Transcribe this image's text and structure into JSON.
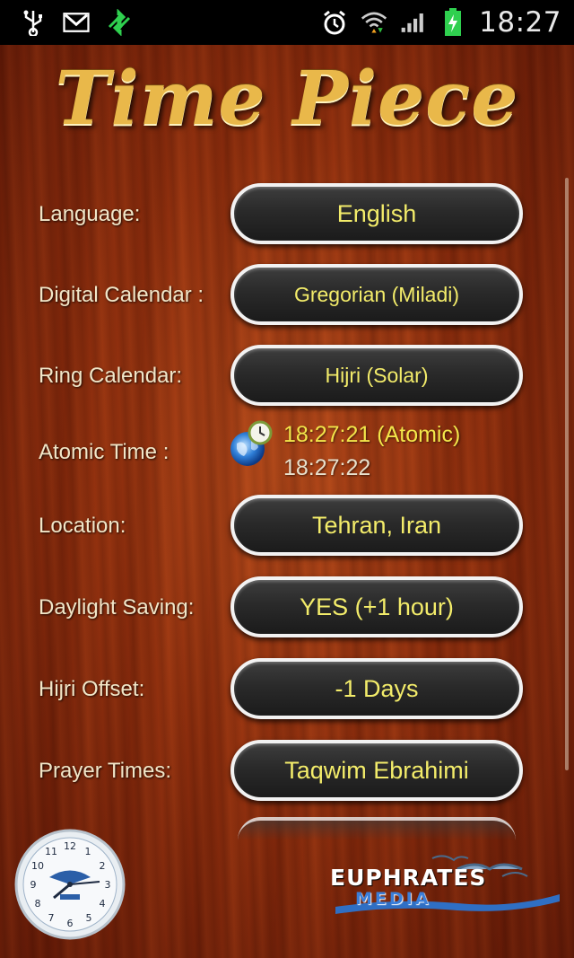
{
  "status_bar": {
    "time": "18:27",
    "icons": [
      "usb-icon",
      "gmail-icon",
      "sync-icon",
      "alarm-icon",
      "wifi-icon",
      "signal-icon",
      "battery-charging-icon"
    ]
  },
  "app": {
    "title": "Time Piece"
  },
  "settings": [
    {
      "label": "Language:",
      "value": "English"
    },
    {
      "label": "Digital Calendar :",
      "value": "Gregorian (Miladi)"
    },
    {
      "label": "Ring Calendar:",
      "value": "Hijri (Solar)"
    },
    {
      "label": "Location:",
      "value": "Tehran, Iran"
    },
    {
      "label": "Daylight Saving:",
      "value": "YES (+1 hour)"
    },
    {
      "label": "Hijri Offset:",
      "value": "-1 Days"
    },
    {
      "label": "Prayer Times:",
      "value": "Taqwim Ebrahimi"
    }
  ],
  "atomic": {
    "label": "Atomic Time :",
    "atomic_time": "18:27:21 (Atomic)",
    "device_time": "18:27:22"
  },
  "footer": {
    "brand_line1": "EUPHRATES",
    "brand_line2": "MEDIA"
  },
  "colors": {
    "accent_text": "#f3ec6a",
    "label_text": "#f1e6c8",
    "wood": "#8f2e0d"
  }
}
